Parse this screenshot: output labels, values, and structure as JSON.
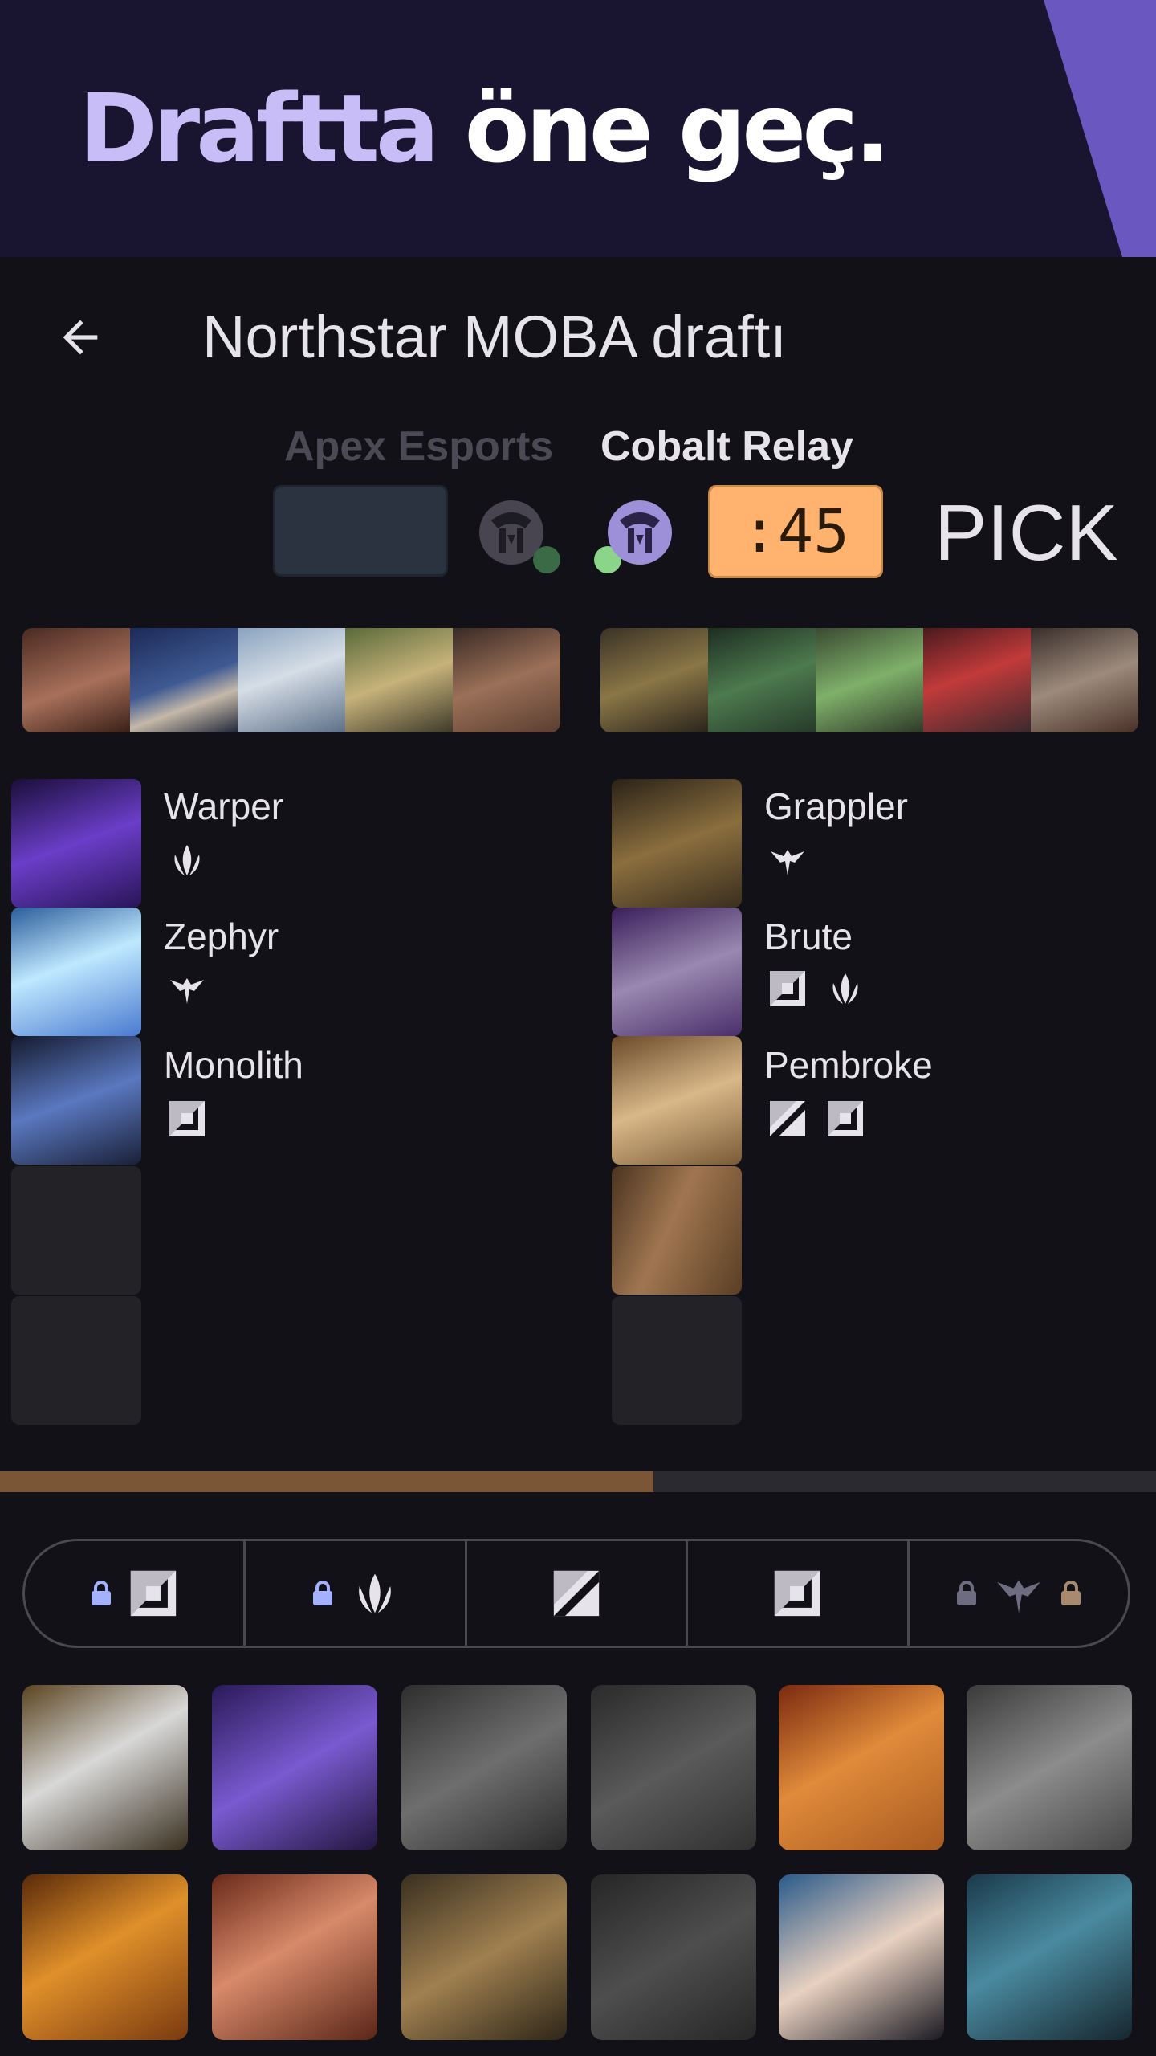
{
  "banner": {
    "headline_accent": "Draftta",
    "headline_rest": "öne geç."
  },
  "appbar": {
    "title": "Northstar MOBA draftı",
    "back_icon": "arrow-left-icon"
  },
  "draft": {
    "team_left": "Apex Esports",
    "team_right": "Cobalt Relay",
    "timer": ":45",
    "phase": "PICK",
    "progress": 0.565
  },
  "bans": {
    "left": [
      "brunette-hero",
      "hat-hero",
      "silver-hair-hero",
      "goggles-hero",
      "bearded-hero"
    ],
    "right": [
      "golden-mask-hero",
      "green-beast-hero",
      "green-goblin-hero",
      "red-hair-hero",
      "skull-hero"
    ]
  },
  "picks": {
    "left": [
      {
        "name": "Warper",
        "roles": [
          "leaf"
        ]
      },
      {
        "name": "Zephyr",
        "roles": [
          "bird"
        ]
      },
      {
        "name": "Monolith",
        "roles": [
          "square"
        ]
      },
      {
        "name": "",
        "roles": []
      },
      {
        "name": "",
        "roles": []
      }
    ],
    "right": [
      {
        "name": "Grappler",
        "roles": [
          "bird"
        ]
      },
      {
        "name": "Brute",
        "roles": [
          "square",
          "leaf"
        ]
      },
      {
        "name": "Pembroke",
        "roles": [
          "slash",
          "square"
        ]
      },
      {
        "name": "",
        "roles": []
      },
      {
        "name": "",
        "roles": []
      }
    ]
  },
  "role_filter": [
    {
      "role": "square",
      "locked": true
    },
    {
      "role": "leaf",
      "locked": true
    },
    {
      "role": "slash",
      "locked": false
    },
    {
      "role": "square",
      "locked": false
    },
    {
      "role": "bird",
      "locked": true
    }
  ],
  "heroes": [
    "masked-hero",
    "violet-hero",
    "bearded-hero-grey",
    "stone-hero-grey",
    "lion-hero",
    "silver-hero-grey",
    "fire-hero",
    "red-hood-hero",
    "bronze-hero",
    "shade-hero-grey",
    "dark-hair-hero",
    "robot-hero"
  ],
  "colors": {
    "accent": "#c8bdf6",
    "timer": "#ffb36e",
    "progress": "#7b5636",
    "banner": "#19142f"
  }
}
